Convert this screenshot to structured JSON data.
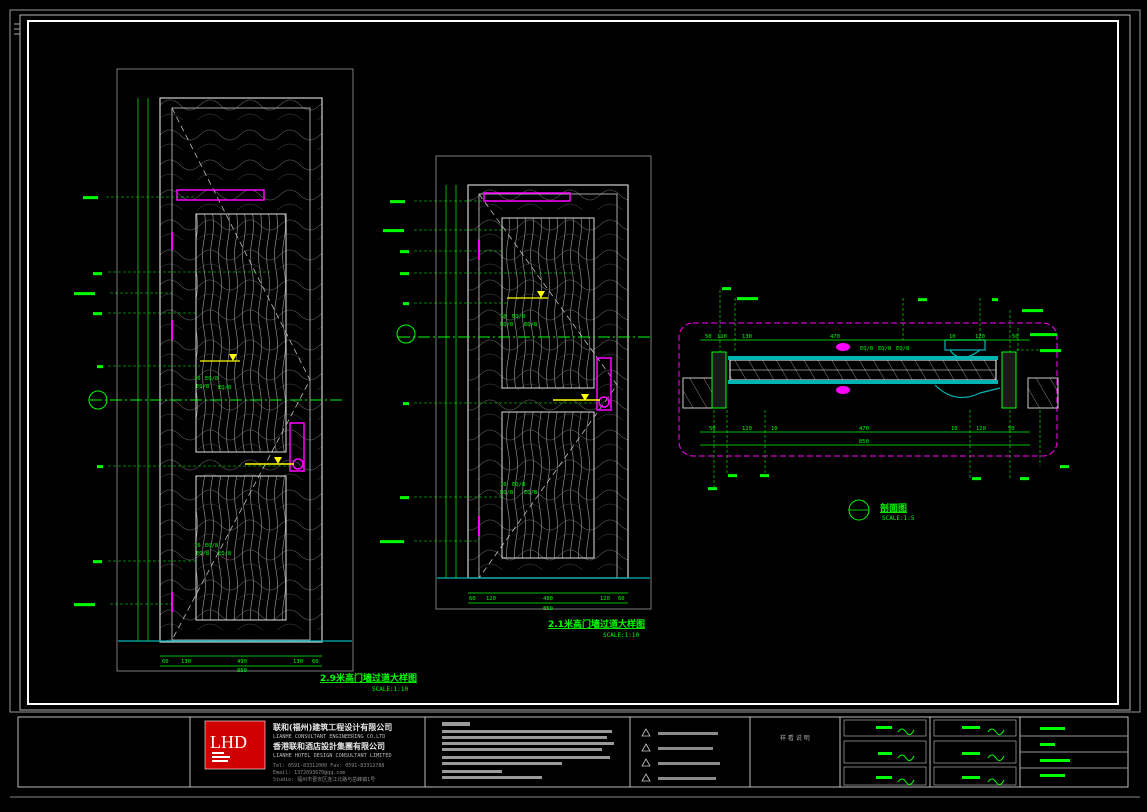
{
  "drawings": {
    "elevation_a": {
      "title": "2.9米高门墙过道大样图",
      "scale": "SCALE:1:10"
    },
    "elevation_b": {
      "title": "2.1米高门墙过道大样图",
      "scale": "SCALE:1:10"
    },
    "section": {
      "title": "剖面图",
      "scale": "SCALE:1:5"
    }
  },
  "section_dims": {
    "top": [
      "50",
      "110",
      "130",
      "470",
      "10",
      "120",
      "50"
    ],
    "bottom": [
      "50",
      "120",
      "10",
      "470",
      "10",
      "120",
      "50"
    ],
    "overall": "850"
  },
  "title_block": {
    "logo_text": "LHD",
    "company_cn_1": "联和(福州)建筑工程设计有限公司",
    "company_en_1": "LIANHE  CONSULTANT  ENGINEERING  CO.LTD",
    "company_cn_2": "香港联和酒店設計集團有限公司",
    "company_en_2": "LIANHE  HOTEL  DESIGN  CONSULTANT  LIMITED",
    "contact_1": "Tel: 0591-83312000   Fax: 0591-83312788",
    "contact_2": "Email: 1372093670@qq.com",
    "contact_3": "Studio: 福州市晋安区连江北路与岳峰镇1号",
    "stamp_label": "样 看 说 明"
  }
}
